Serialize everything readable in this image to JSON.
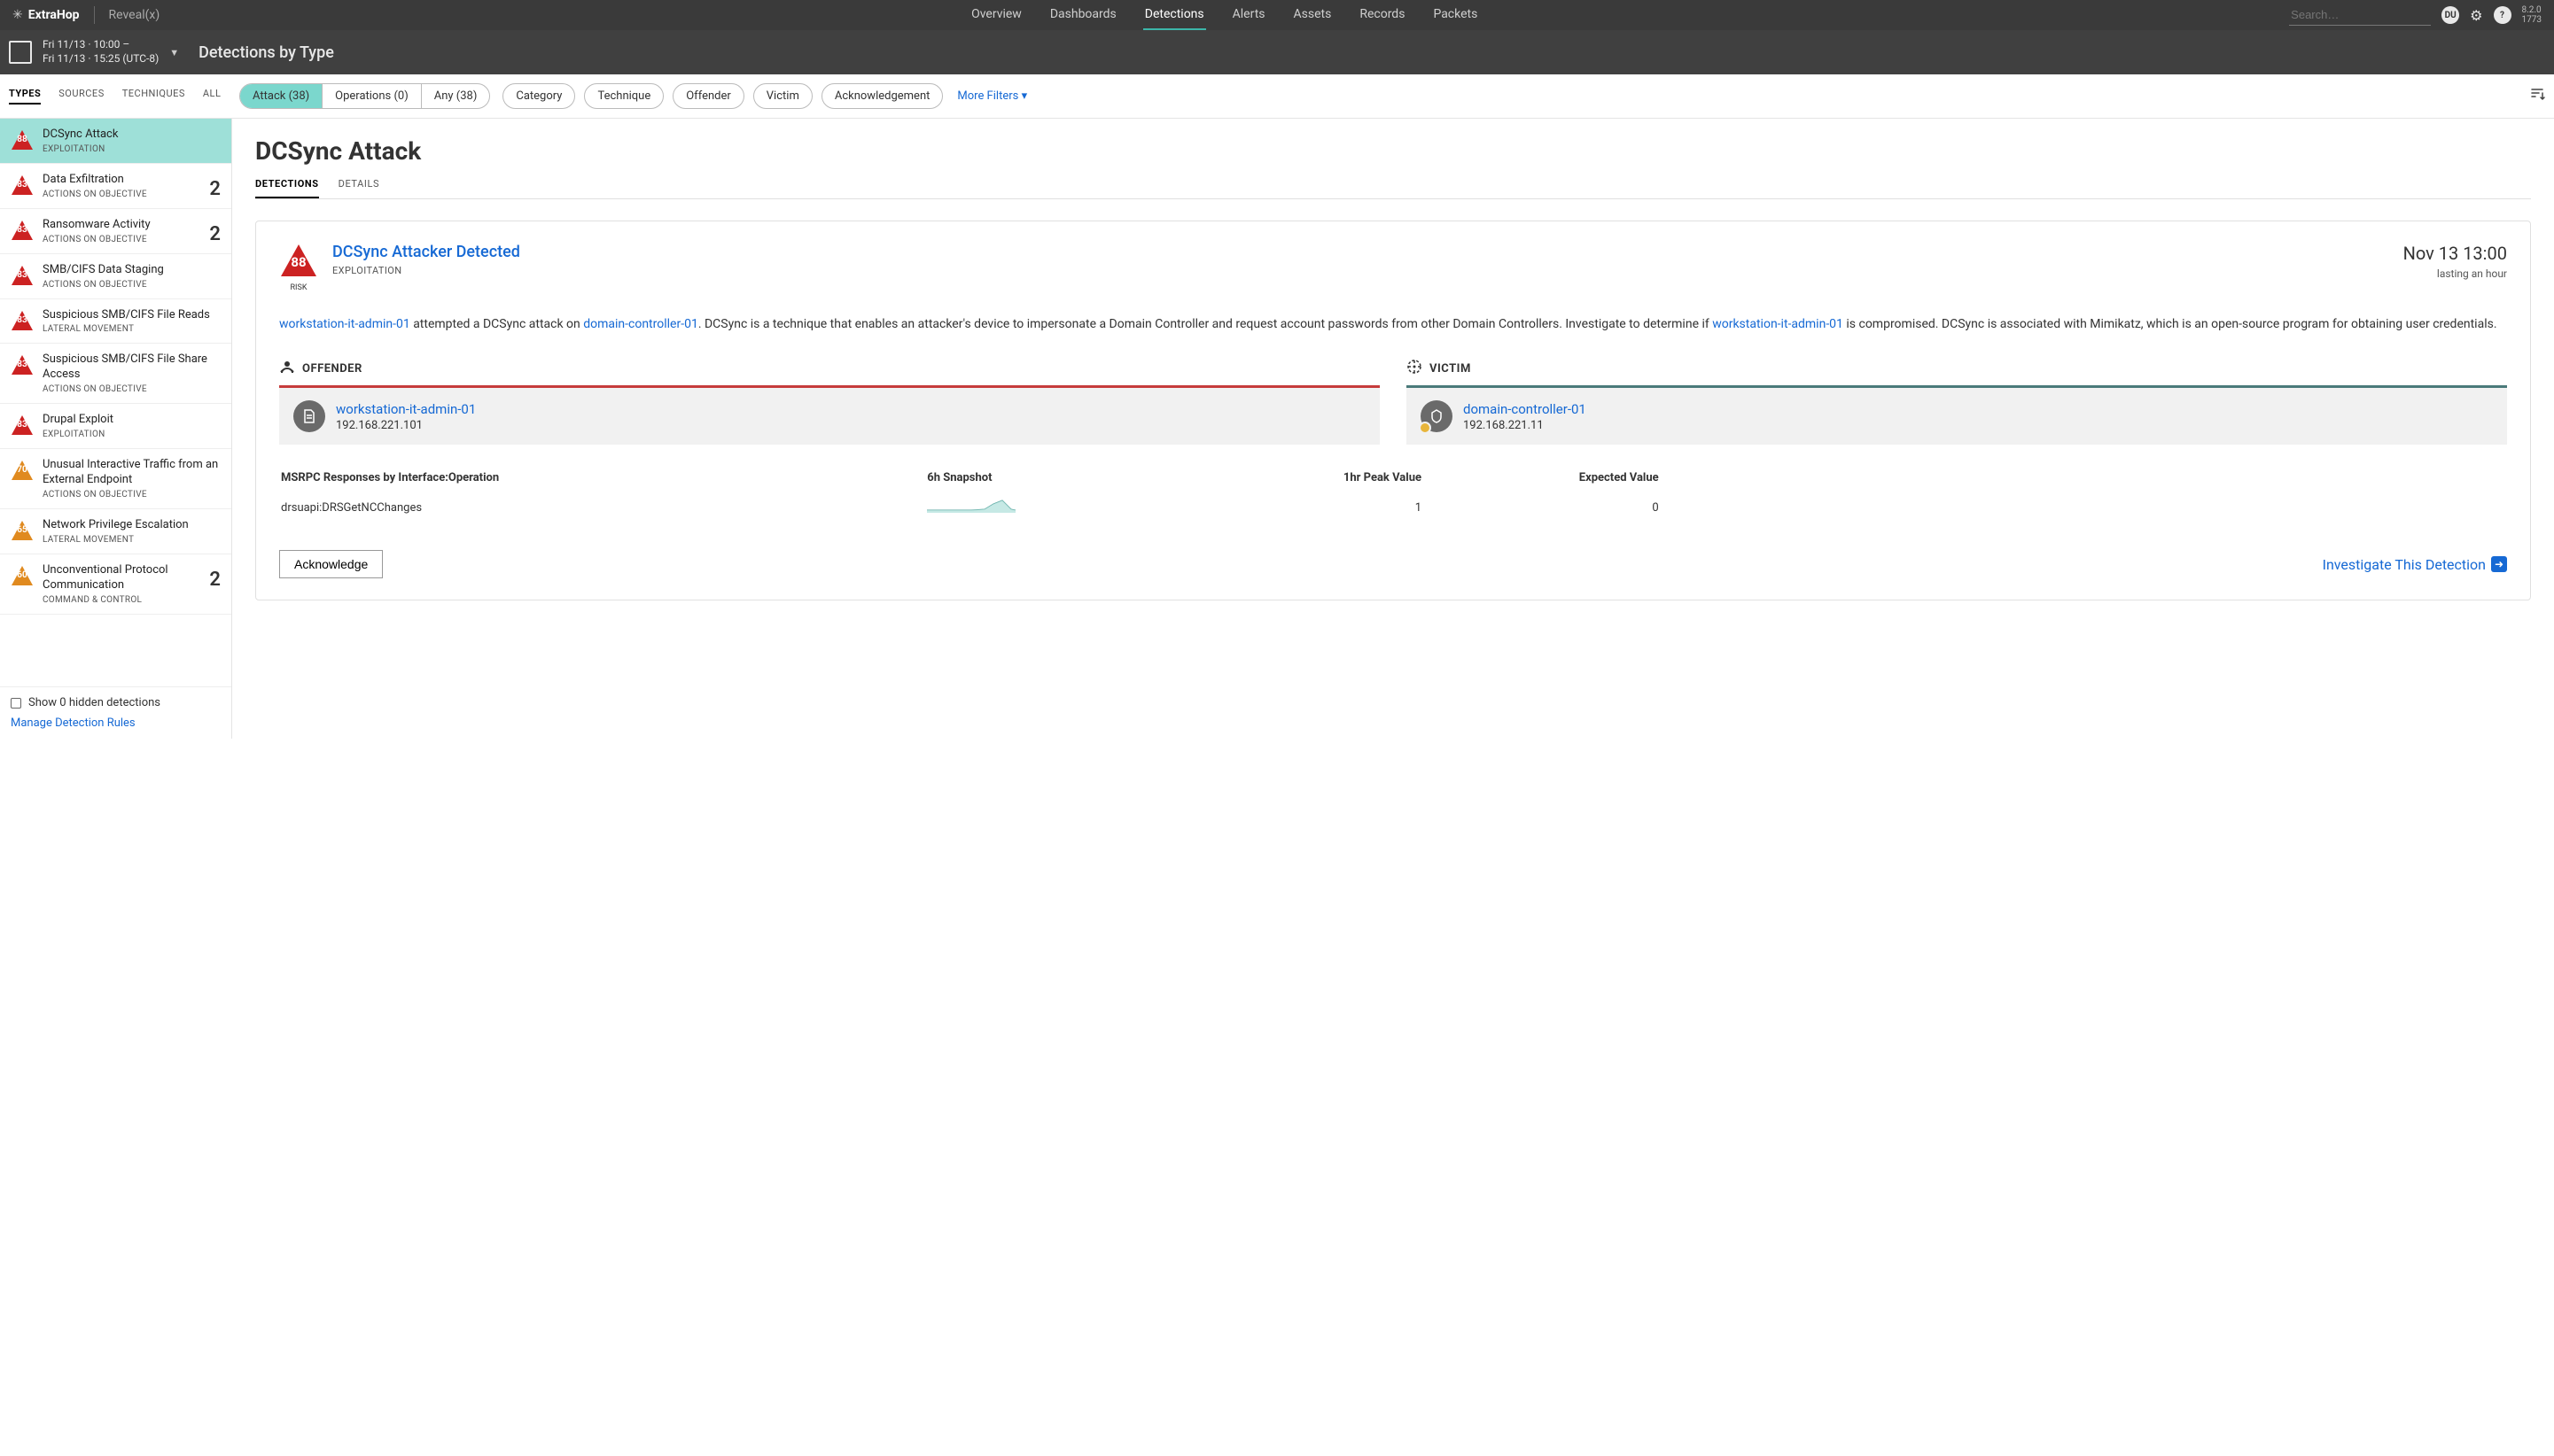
{
  "brand": {
    "name": "ExtraHop",
    "product": "Reveal(x)"
  },
  "topnav": {
    "items": [
      "Overview",
      "Dashboards",
      "Detections",
      "Alerts",
      "Assets",
      "Records",
      "Packets"
    ],
    "active": "Detections"
  },
  "version": {
    "line1": "8.2.0",
    "line2": "1773"
  },
  "search": {
    "placeholder": "Search…"
  },
  "user_badge": "DU",
  "timerange": {
    "line1": "Fri 11/13 · 10:00 –",
    "line2": "Fri 11/13 · 15:25 (UTC-8)"
  },
  "page_title": "Detections by Type",
  "sidebar_tabs": {
    "items": [
      "TYPES",
      "SOURCES",
      "TECHNIQUES",
      "ALL"
    ],
    "active": "TYPES"
  },
  "segments": {
    "attack": "Attack (38)",
    "operations": "Operations (0)",
    "any": "Any (38)"
  },
  "filters": {
    "category": "Category",
    "technique": "Technique",
    "offender": "Offender",
    "victim": "Victim",
    "ack": "Acknowledgement",
    "more": "More Filters"
  },
  "detections_list": [
    {
      "risk": "88",
      "color": "#c22",
      "title": "DCSync Attack",
      "sub": "EXPLOITATION",
      "count": ""
    },
    {
      "risk": "83",
      "color": "#c22",
      "title": "Data Exfiltration",
      "sub": "ACTIONS ON OBJECTIVE",
      "count": "2"
    },
    {
      "risk": "83",
      "color": "#c22",
      "title": "Ransomware Activity",
      "sub": "ACTIONS ON OBJECTIVE",
      "count": "2"
    },
    {
      "risk": "83",
      "color": "#c22",
      "title": "SMB/CIFS Data Staging",
      "sub": "ACTIONS ON OBJECTIVE",
      "count": ""
    },
    {
      "risk": "83",
      "color": "#c22",
      "title": "Suspicious SMB/CIFS File Reads",
      "sub": "LATERAL MOVEMENT",
      "count": ""
    },
    {
      "risk": "83",
      "color": "#c22",
      "title": "Suspicious SMB/CIFS File Share Access",
      "sub": "ACTIONS ON OBJECTIVE",
      "count": ""
    },
    {
      "risk": "83",
      "color": "#c22",
      "title": "Drupal Exploit",
      "sub": "EXPLOITATION",
      "count": ""
    },
    {
      "risk": "70",
      "color": "#e08a1f",
      "title": "Unusual Interactive Traffic from an External Endpoint",
      "sub": "ACTIONS ON OBJECTIVE",
      "count": ""
    },
    {
      "risk": "65",
      "color": "#e08a1f",
      "title": "Network Privilege Escalation",
      "sub": "LATERAL MOVEMENT",
      "count": ""
    },
    {
      "risk": "60",
      "color": "#e08a1f",
      "title": "Unconventional Protocol Communication",
      "sub": "COMMAND & CONTROL",
      "count": "2"
    }
  ],
  "hidden_line": "Show 0 hidden detections",
  "manage_rules": "Manage Detection Rules",
  "detail_title": "DCSync Attack",
  "detail_tabs": {
    "items": [
      "DETECTIONS",
      "DETAILS"
    ],
    "active": "DETECTIONS"
  },
  "card": {
    "risk": "88",
    "risk_label": "RISK",
    "title": "DCSync Attacker Detected",
    "sub": "EXPLOITATION",
    "ts": "Nov 13 13:00",
    "duration": "lasting an hour",
    "desc_host1": "workstation-it-admin-01",
    "desc_mid1": " attempted a DCSync attack on ",
    "desc_host2": "domain-controller-01",
    "desc_mid2": ". DCSync is a technique that enables an attacker's device to impersonate a Domain Controller and request account passwords from other Domain Controllers. Investigate to determine if ",
    "desc_host3": "workstation-it-admin-01",
    "desc_mid3": " is compromised. DCSync is associated with Mimikatz, which is an open-source program for obtaining user credentials.",
    "offender_label": "OFFENDER",
    "victim_label": "VICTIM",
    "offender": {
      "name": "workstation-it-admin-01",
      "ip": "192.168.221.101"
    },
    "victim": {
      "name": "domain-controller-01",
      "ip": "192.168.221.11"
    },
    "metrics_headers": {
      "c1": "MSRPC Responses by Interface:Operation",
      "c2": "6h Snapshot",
      "c3": "1hr Peak Value",
      "c4": "Expected Value"
    },
    "metrics_row": {
      "label": "drsuapi:DRSGetNCChanges",
      "peak": "1",
      "expected": "0"
    },
    "ack": "Acknowledge",
    "investigate": "Investigate This Detection"
  }
}
